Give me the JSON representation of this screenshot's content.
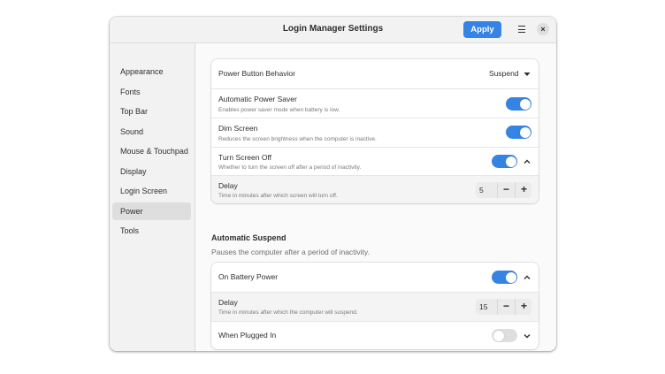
{
  "window": {
    "title": "Login Manager Settings",
    "apply_label": "Apply",
    "close_glyph": "×"
  },
  "sidebar": {
    "items": [
      {
        "label": "Appearance"
      },
      {
        "label": "Fonts"
      },
      {
        "label": "Top Bar"
      },
      {
        "label": "Sound"
      },
      {
        "label": "Mouse & Touchpad"
      },
      {
        "label": "Display"
      },
      {
        "label": "Login Screen"
      },
      {
        "label": "Power"
      },
      {
        "label": "Tools"
      }
    ],
    "selected": "Power"
  },
  "power": {
    "button_behavior": {
      "label": "Power Button Behavior",
      "value": "Suspend"
    },
    "auto_power_saver": {
      "label": "Automatic Power Saver",
      "subtitle": "Enables power saver mode when battery is low.",
      "enabled": true
    },
    "dim_screen": {
      "label": "Dim Screen",
      "subtitle": "Reduces the screen brightness when the computer is inactive.",
      "enabled": true
    },
    "turn_screen_off": {
      "label": "Turn Screen Off",
      "subtitle": "Whether to turn the screen off after a period of inactivity.",
      "enabled": true,
      "expanded": true
    },
    "screen_delay": {
      "label": "Delay",
      "subtitle": "Time in minutes after which screen will turn off.",
      "value": "5"
    }
  },
  "auto_suspend": {
    "title": "Automatic Suspend",
    "subtitle": "Pauses the computer after a period of inactivity.",
    "on_battery": {
      "label": "On Battery Power",
      "enabled": true,
      "expanded": true
    },
    "battery_delay": {
      "label": "Delay",
      "subtitle": "Time in minutes after which the computer will suspend.",
      "value": "15"
    },
    "plugged_in": {
      "label": "When Plugged In",
      "enabled": false,
      "expanded": false
    }
  },
  "glyphs": {
    "minus": "−",
    "plus": "+"
  },
  "colors": {
    "accent": "#3584e4",
    "toggle_off": "#dedede"
  },
  "icons": [
    "hamburger-menu-icon",
    "close-icon",
    "dropdown-arrow-icon",
    "chevron-up-icon",
    "chevron-down-icon"
  ]
}
